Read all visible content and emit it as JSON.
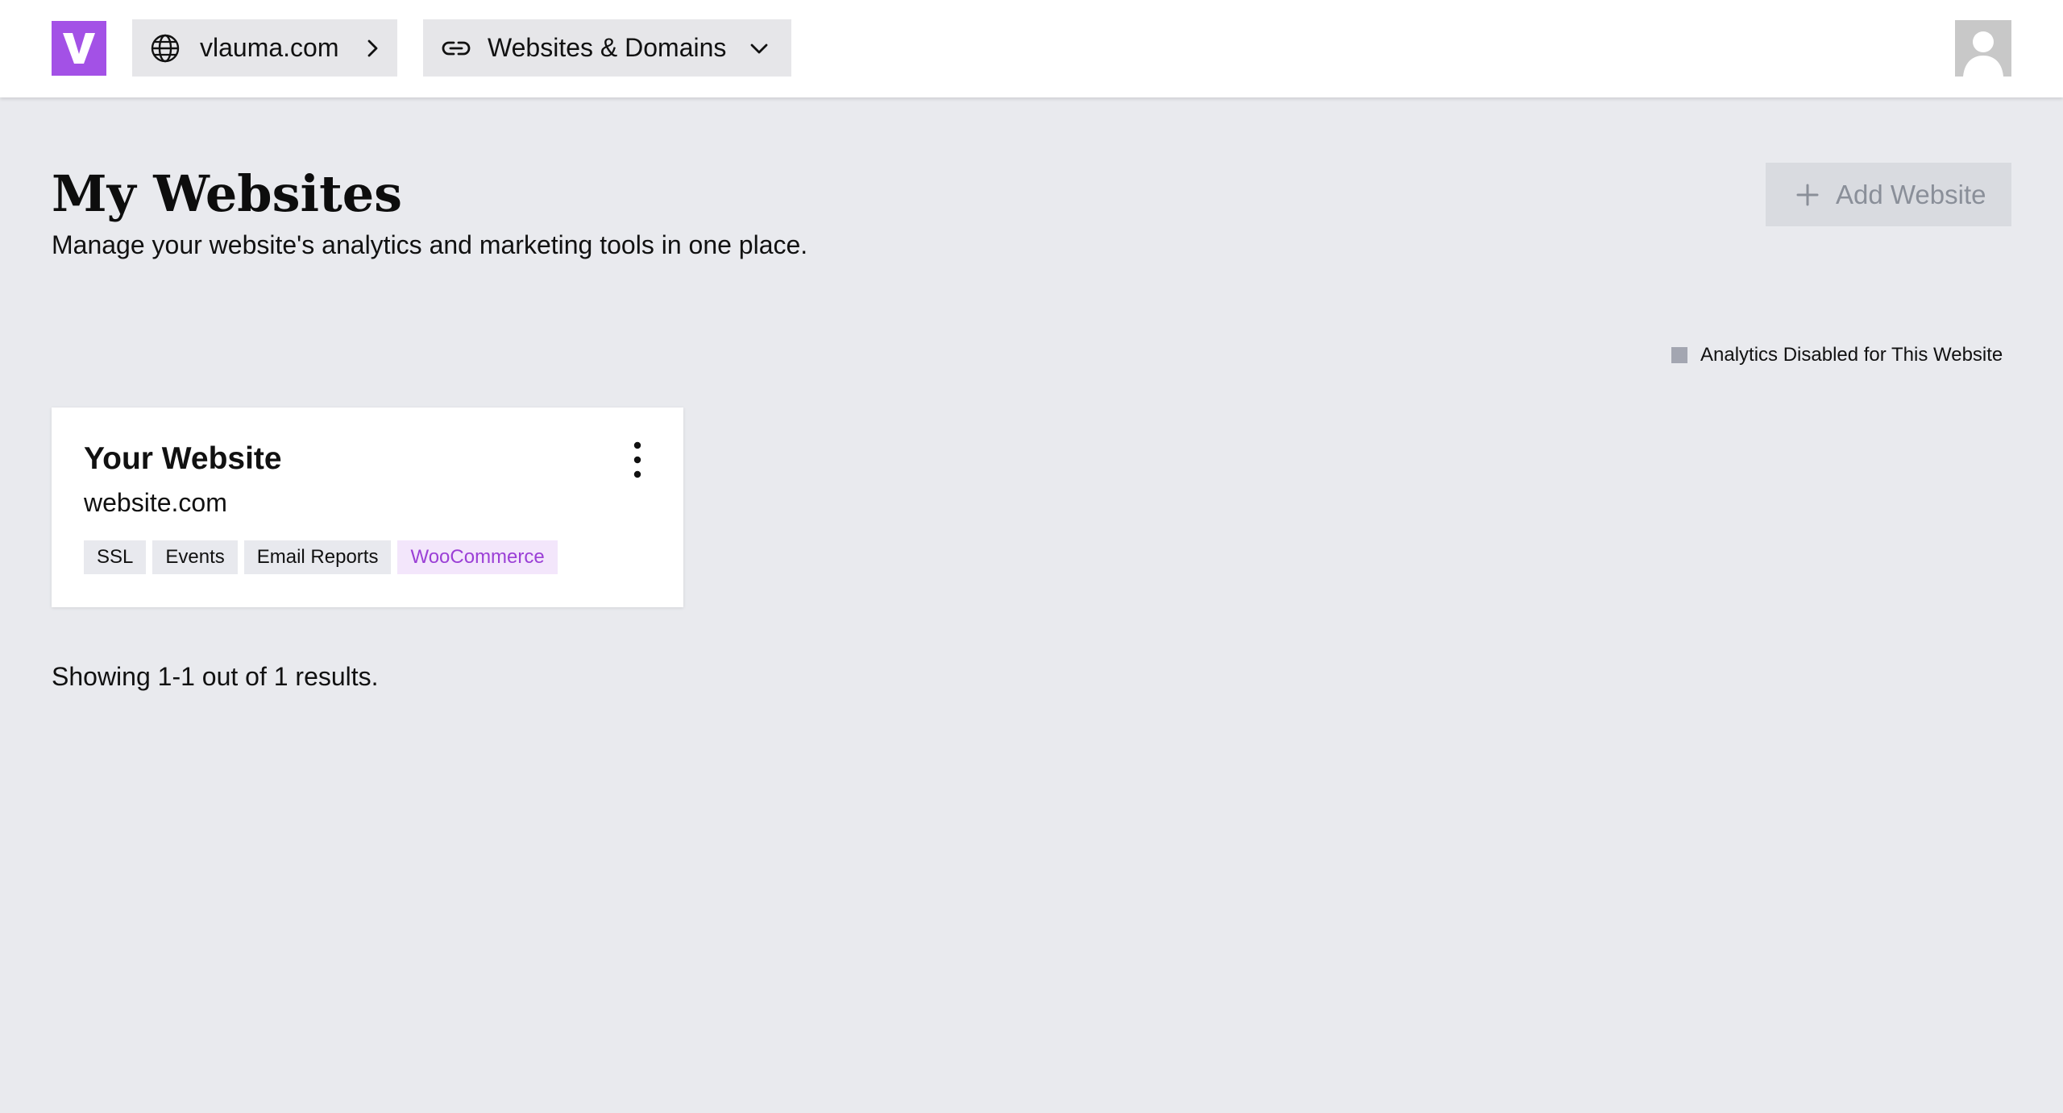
{
  "colors": {
    "brand": "#a351e6",
    "page_background": "#e9eaee",
    "tag_accent_text": "#9b3fd6",
    "tag_accent_background": "#f3e6fb",
    "legend_swatch": "#a3a6b1"
  },
  "header": {
    "logo_icon": "v-logo-icon",
    "breadcrumb": [
      {
        "label": "vlauma.com",
        "icon": "globe-icon",
        "trail_icon": "chevron-right-icon"
      },
      {
        "label": "Websites & Domains",
        "icon": "link-icon",
        "trail_icon": "chevron-down-icon"
      }
    ],
    "avatar_icon": "user-avatar-icon"
  },
  "main": {
    "title": "My Websites",
    "subtitle": "Manage your website's analytics and marketing tools in one place.",
    "add_button": {
      "label": "Add Website",
      "icon": "plus-icon"
    },
    "legend": {
      "label": "Analytics Disabled for This Website"
    },
    "websites": [
      {
        "name": "Your Website",
        "domain": "website.com",
        "menu_icon": "kebab-menu-icon",
        "tags": [
          {
            "label": "SSL",
            "accent": false
          },
          {
            "label": "Events",
            "accent": false
          },
          {
            "label": "Email Reports",
            "accent": false
          },
          {
            "label": "WooCommerce",
            "accent": true
          }
        ]
      }
    ],
    "results_text": "Showing 1-1 out of 1 results."
  }
}
